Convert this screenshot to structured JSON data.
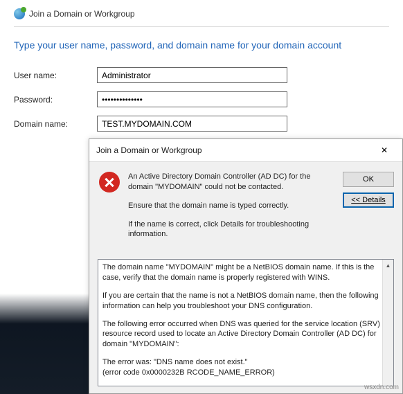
{
  "main": {
    "title": "Join a Domain or Workgroup",
    "heading": "Type your user name, password, and domain name for your domain account",
    "labels": {
      "username": "User name:",
      "password": "Password:",
      "domain": "Domain name:"
    },
    "values": {
      "username": "Administrator",
      "password": "••••••••••••••",
      "domain": "TEST.MYDOMAIN.COM"
    }
  },
  "dialog": {
    "title": "Join a Domain or Workgroup",
    "msg1": "An Active Directory Domain Controller (AD DC) for the domain \"MYDOMAIN\" could not be contacted.",
    "msg2": "Ensure that the domain name is typed correctly.",
    "msg3": "If the name is correct, click Details for troubleshooting information.",
    "ok": "OK",
    "details_btn": "<< Details",
    "details": {
      "p1": "The domain name \"MYDOMAIN\" might be a NetBIOS domain name.  If this is the case, verify that the domain name is properly registered with WINS.",
      "p2": "If you are certain that the name is not a NetBIOS domain name, then the following information can help you troubleshoot your DNS configuration.",
      "p3": "The following error occurred when DNS was queried for the service location (SRV) resource record used to locate an Active Directory Domain Controller (AD DC) for domain \"MYDOMAIN\":",
      "p4": "The error was: \"DNS name does not exist.\"",
      "p5": "(error code 0x0000232B RCODE_NAME_ERROR)"
    }
  },
  "watermark": "wsxdn.com"
}
